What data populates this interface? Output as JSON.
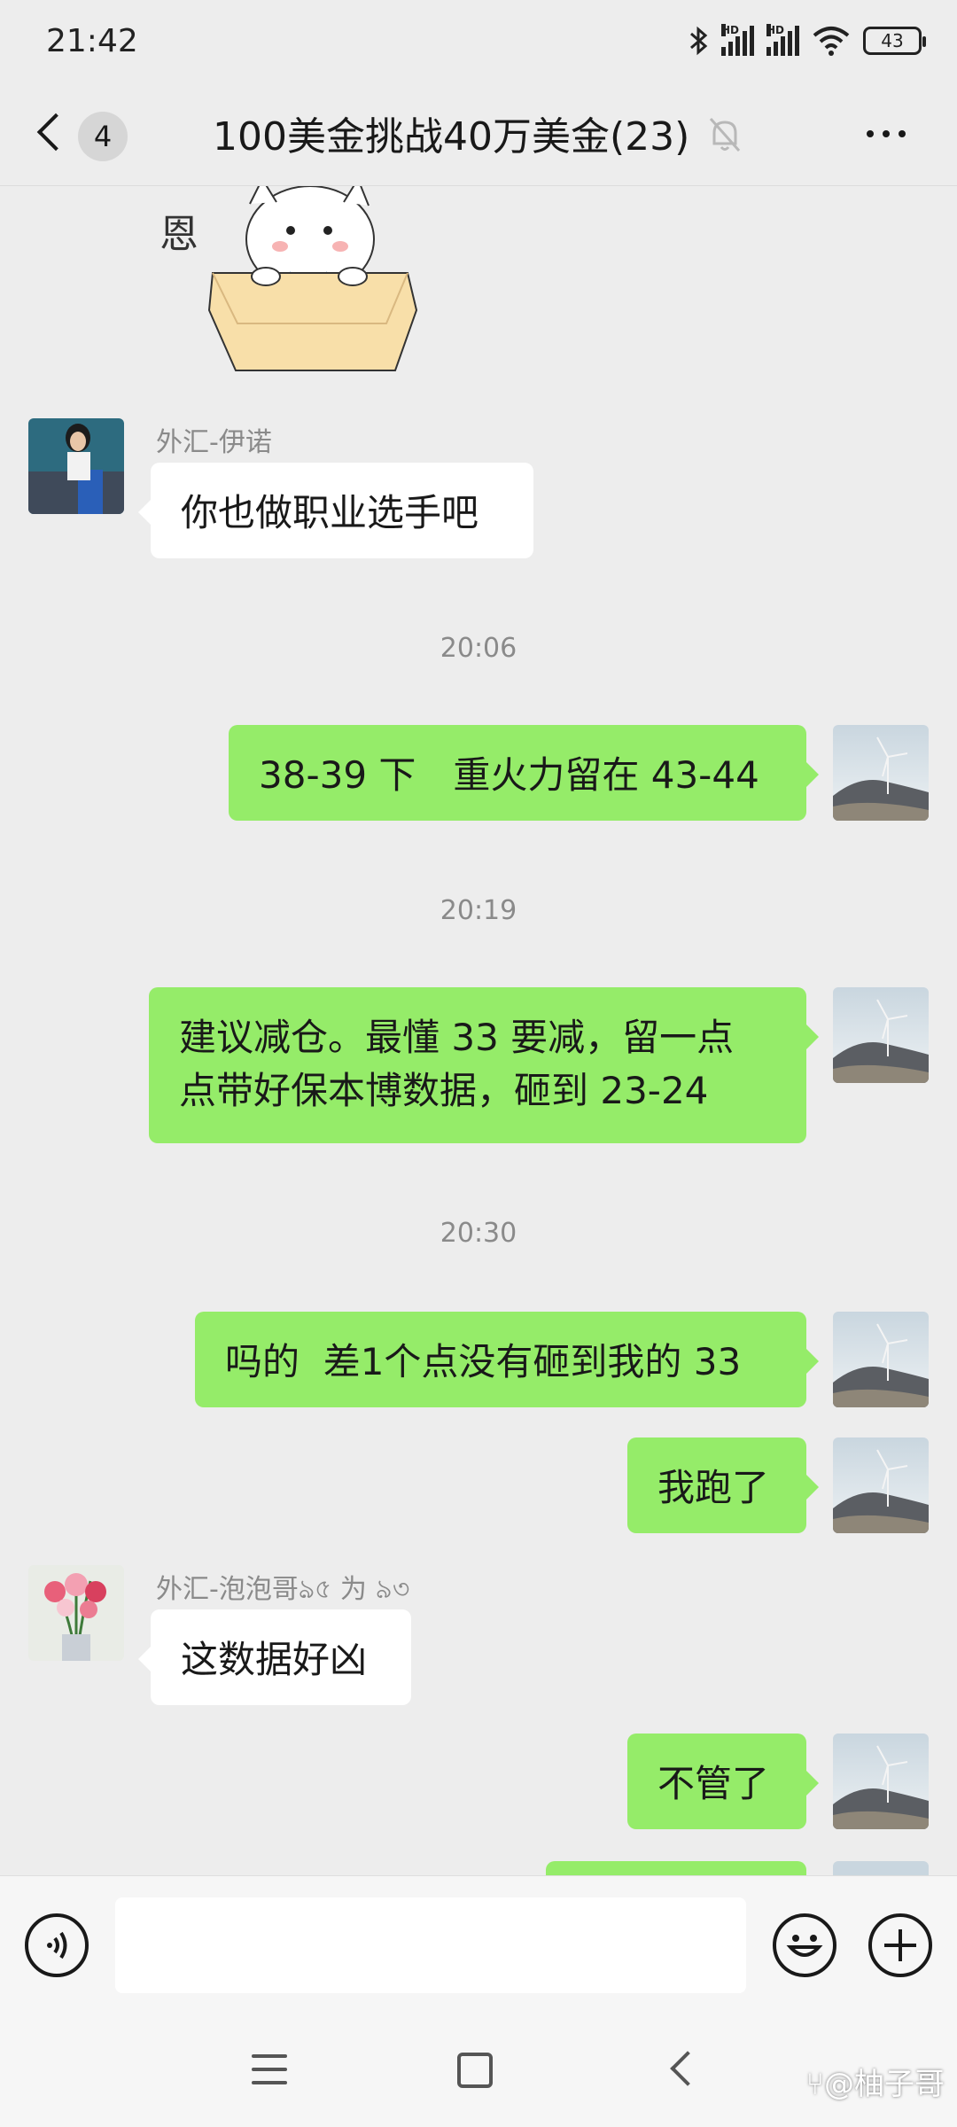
{
  "status_bar": {
    "time": "21:42",
    "network_1": "HD",
    "network_2": "HD",
    "battery": "43"
  },
  "header": {
    "unread_count": "4",
    "title": "100美金挑战40万美金(23)"
  },
  "messages": [
    {
      "type": "sticker",
      "side": "left",
      "sticker_text": "恩"
    },
    {
      "type": "text",
      "side": "left",
      "sender": "外汇-伊诺",
      "text": "你也做职业选手吧"
    },
    {
      "type": "time",
      "text": "20:06"
    },
    {
      "type": "text",
      "side": "right",
      "text": "38-39 下　重火力留在 43-44"
    },
    {
      "type": "time",
      "text": "20:19"
    },
    {
      "type": "text",
      "side": "right",
      "line1": "建议减仓。最懂 33 要减，留一点",
      "line2": "点带好保本博数据，砸到 23-24"
    },
    {
      "type": "time",
      "text": "20:30"
    },
    {
      "type": "text",
      "side": "right",
      "text": "吗的  差1个点没有砸到我的 33"
    },
    {
      "type": "text",
      "side": "right",
      "text": "我跑了"
    },
    {
      "type": "text",
      "side": "left",
      "sender": "外汇-泡泡哥ঌ৫ 为 ৯৩",
      "text": "这数据好凶"
    },
    {
      "type": "text",
      "side": "right",
      "text": "不管了"
    }
  ],
  "watermark": "⑂@柚子哥",
  "colors": {
    "background": "#ededed",
    "bubble_self": "#95ec69",
    "bubble_other": "#ffffff",
    "secondary_text": "#8a8a8a"
  },
  "icons": {
    "back": "chevron-left-icon",
    "mute": "bell-off-icon",
    "more": "more-dots-icon",
    "voice": "voice-icon",
    "emoji": "emoji-icon",
    "plus": "plus-icon"
  }
}
